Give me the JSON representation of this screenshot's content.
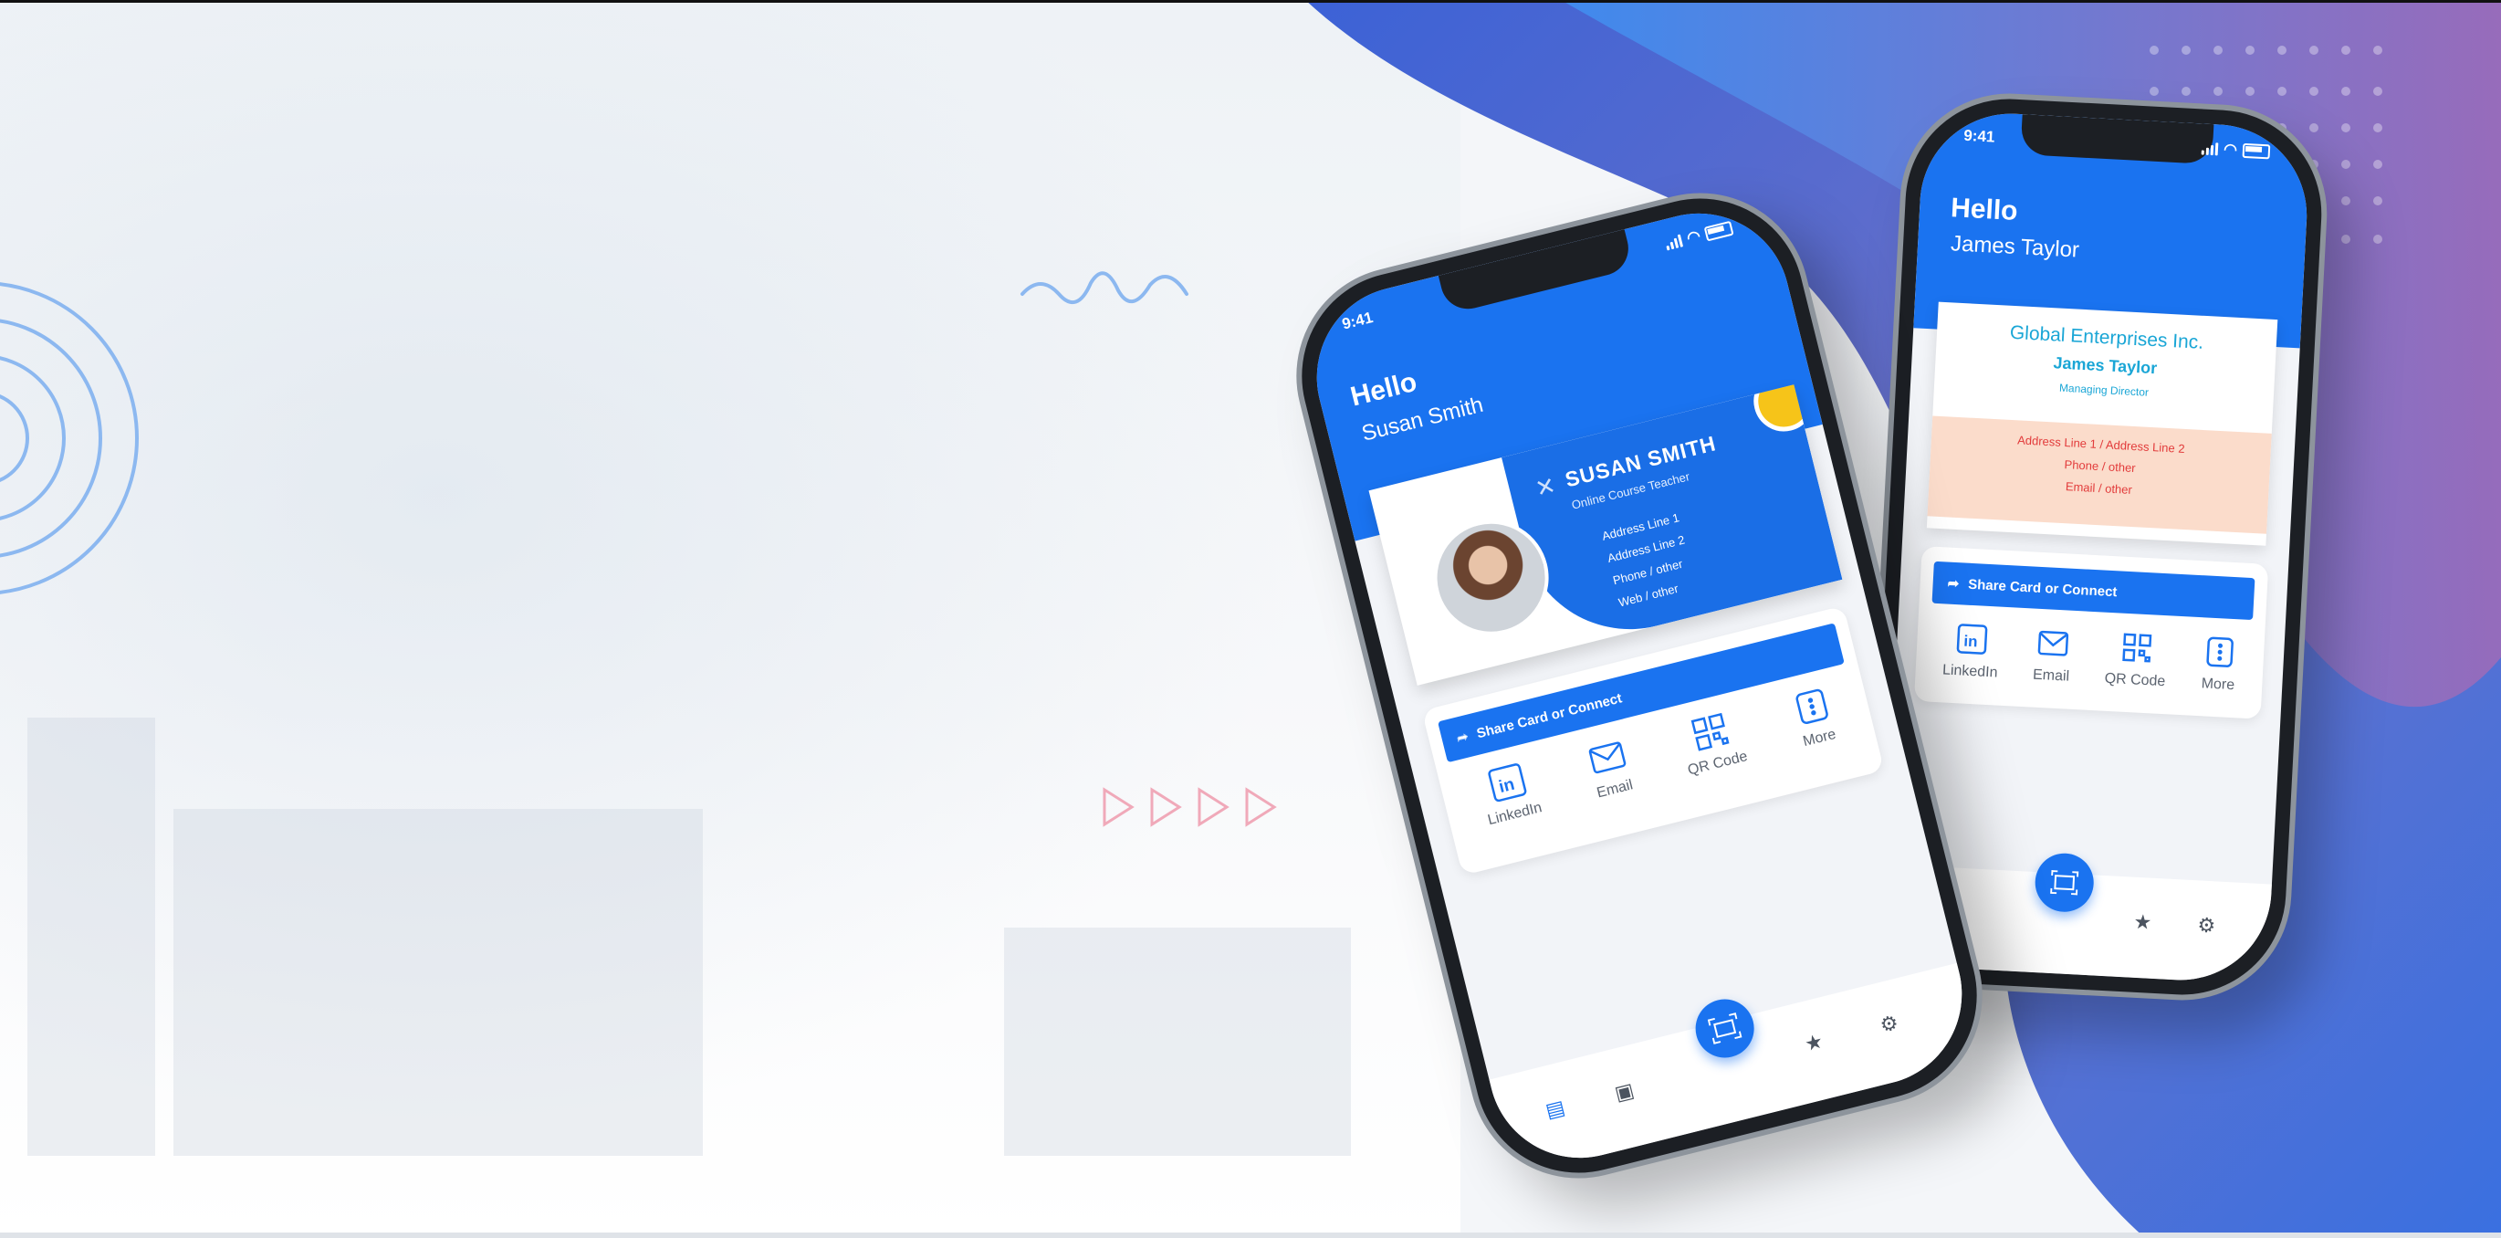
{
  "colors": {
    "brand": "#1a73f0",
    "accent_text": "#1aa6d6",
    "address_text": "#e23b3b",
    "address_bg": "#fbdccb",
    "wave": "#8cb8f0",
    "arrows": "#f0a9b9"
  },
  "phone_front": {
    "status_time": "9:41",
    "greeting": "Hello",
    "user_name": "Susan Smith",
    "card": {
      "first_name": "SUSAN",
      "last_name": "SMITH",
      "role": "Online Course Teacher",
      "lines": [
        "Address Line 1",
        "Address Line 2",
        "Phone / other",
        "Web / other"
      ]
    },
    "share_label": "Share Card or Connect",
    "actions": [
      {
        "label": "LinkedIn",
        "icon": "linkedin-icon"
      },
      {
        "label": "Email",
        "icon": "email-icon"
      },
      {
        "label": "QR Code",
        "icon": "qr-code-icon"
      },
      {
        "label": "More",
        "icon": "more-icon"
      }
    ],
    "nav": [
      "contact-card-icon",
      "document-icon",
      "scan-card-icon",
      "star-icon",
      "gear-icon"
    ]
  },
  "phone_back": {
    "status_time": "9:41",
    "greeting": "Hello",
    "user_name": "James Taylor",
    "card": {
      "company": "Global  Enterprises Inc.",
      "name": "James Taylor",
      "title": "Managing Director",
      "lines": [
        "Address Line 1 / Address Line 2",
        "Phone / other",
        "Email / other"
      ]
    },
    "share_label": "Share Card or Connect",
    "actions": [
      {
        "label": "LinkedIn",
        "icon": "linkedin-icon"
      },
      {
        "label": "Email",
        "icon": "email-icon"
      },
      {
        "label": "QR Code",
        "icon": "qr-code-icon"
      },
      {
        "label": "More",
        "icon": "more-icon"
      }
    ],
    "nav": [
      "document-icon",
      "scan-card-icon",
      "star-icon",
      "gear-icon"
    ]
  }
}
